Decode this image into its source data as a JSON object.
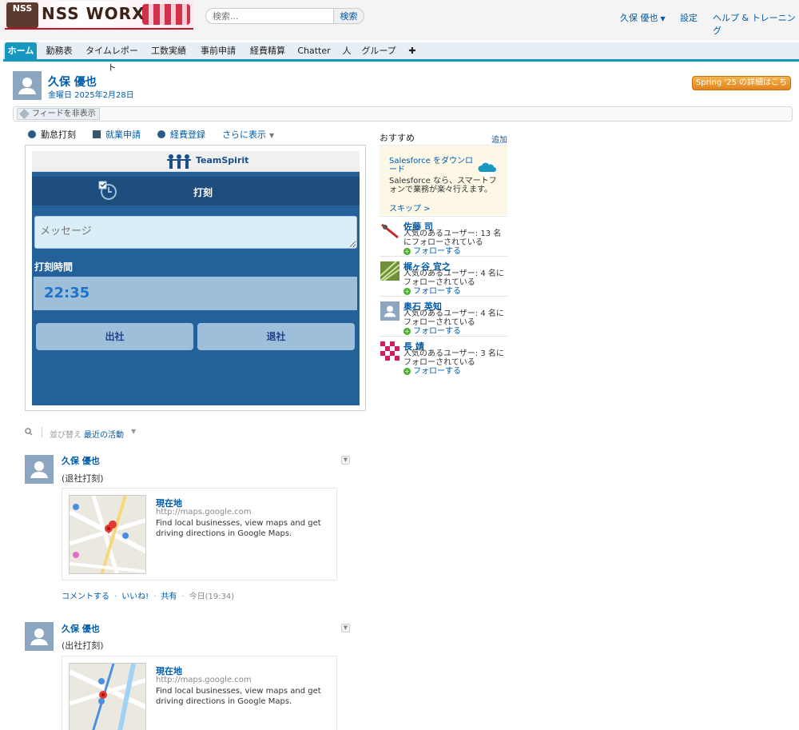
{
  "header": {
    "logo_mark": "NSS",
    "logo_text": "NSS WORX",
    "search_placeholder": "検索...",
    "search_button": "検索",
    "user_name": "久保 優也",
    "settings": "設定",
    "help": "ヘルプ & トレーニング"
  },
  "tabs": [
    {
      "label": "ホーム"
    },
    {
      "label": "勤務表"
    },
    {
      "label": "タイムレポート"
    },
    {
      "label": "工数実績"
    },
    {
      "label": "事前申請"
    },
    {
      "label": "経費精算"
    },
    {
      "label": "Chatter"
    },
    {
      "label": "人"
    },
    {
      "label": "グループ"
    },
    {
      "label": "✚"
    }
  ],
  "profile": {
    "name": "久保 優也",
    "date": "金曜日 2025年2月28日",
    "spring_button": "Spring '25 の詳細はこちら",
    "feed_toggle": "フィードを非表示"
  },
  "publisher_tabs": {
    "kintai": "勤怠打刻",
    "shugyo": "就業申請",
    "keihi": "経費登録",
    "more": "さらに表示"
  },
  "teamspirit": {
    "brand": "TeamSpirit",
    "title": "打刻",
    "message_placeholder": "メッセージ",
    "time_label": "打刻時間",
    "time": "22:35",
    "clock_in": "出社",
    "clock_out": "退社"
  },
  "sort": {
    "label": "並び替え",
    "value": "最近の活動"
  },
  "posts": [
    {
      "author": "久保 優也",
      "text": "(退社打刻)",
      "card_title": "現在地",
      "card_url": "http://maps.google.com",
      "card_desc": "Find local businesses, view maps and get driving directions in Google Maps.",
      "actions": {
        "comment": "コメントする",
        "like": "いいね!",
        "share": "共有",
        "timestamp": "今日(19:34)"
      }
    },
    {
      "author": "久保 優也",
      "text": "(出社打刻)",
      "card_title": "現在地",
      "card_url": "http://maps.google.com",
      "card_desc": "Find local businesses, view maps and get driving directions in Google Maps."
    }
  ],
  "recommendations": {
    "title": "おすすめ",
    "add": "追加",
    "promo": {
      "title": "Salesforce をダウンロード",
      "desc": "Salesforce なら、スマートフォンで業務が楽々行えます。",
      "skip": "スキップ >"
    },
    "follow_label": "フォローする",
    "people": [
      {
        "name": "佐藤 司",
        "desc": "人気のあるユーザー: 13 名にフォローされている"
      },
      {
        "name": "梶ヶ谷 宜之",
        "desc": "人気のあるユーザー: 4 名にフォローされている"
      },
      {
        "name": "奥石 英知",
        "desc": "人気のあるユーザー: 4 名にフォローされている"
      },
      {
        "name": "長 靖",
        "desc": "人気のあるユーザー: 3 名にフォローされている"
      }
    ]
  },
  "colors": {
    "tab_active": "#1797c0",
    "link": "#015ba7",
    "panel": "#24609a",
    "spring": "#e3831d"
  }
}
